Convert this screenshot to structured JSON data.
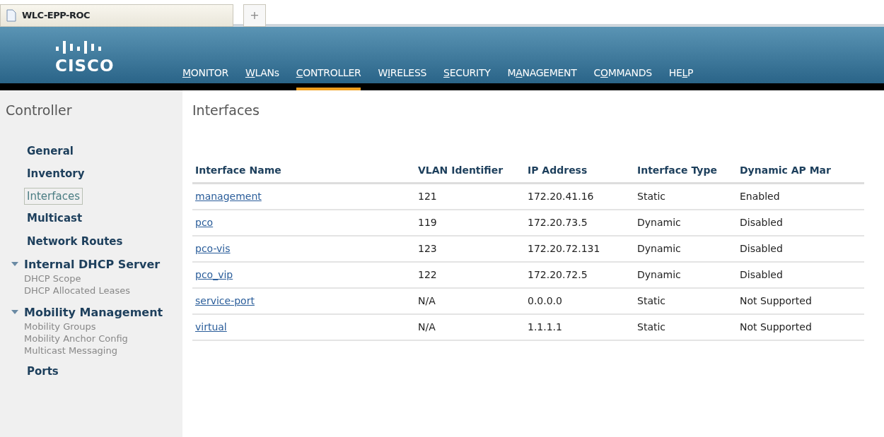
{
  "browser_tab": {
    "title": "WLC-EPP-ROC",
    "new_tab": "+"
  },
  "header": {
    "logo": "CISCO",
    "menu": [
      {
        "parts": [
          {
            "text": "M",
            "underlined": true
          },
          {
            "text": "ONITOR",
            "underlined": false
          }
        ],
        "selected": false
      },
      {
        "parts": [
          {
            "text": "W",
            "underlined": true
          },
          {
            "text": "LANs",
            "underlined": false
          }
        ],
        "selected": false
      },
      {
        "parts": [
          {
            "text": "C",
            "underlined": true
          },
          {
            "text": "ONTROLLER",
            "underlined": false
          }
        ],
        "selected": true
      },
      {
        "parts": [
          {
            "text": "W",
            "underlined": false
          },
          {
            "text": "I",
            "underlined": true
          },
          {
            "text": "RELESS",
            "underlined": false
          }
        ],
        "selected": false
      },
      {
        "parts": [
          {
            "text": "S",
            "underlined": true
          },
          {
            "text": "ECURITY",
            "underlined": false
          }
        ],
        "selected": false
      },
      {
        "parts": [
          {
            "text": "M",
            "underlined": false
          },
          {
            "text": "A",
            "underlined": true
          },
          {
            "text": "NAGEMENT",
            "underlined": false
          }
        ],
        "selected": false
      },
      {
        "parts": [
          {
            "text": "C",
            "underlined": false
          },
          {
            "text": "O",
            "underlined": true
          },
          {
            "text": "MMANDS",
            "underlined": false
          }
        ],
        "selected": false
      },
      {
        "parts": [
          {
            "text": "HE",
            "underlined": false
          },
          {
            "text": "L",
            "underlined": true
          },
          {
            "text": "P",
            "underlined": false
          }
        ],
        "selected": false
      }
    ]
  },
  "sidebar": {
    "title": "Controller",
    "items": [
      {
        "kind": "section",
        "label": "General",
        "selected": false
      },
      {
        "kind": "section",
        "label": "Inventory",
        "selected": false
      },
      {
        "kind": "section",
        "label": "Interfaces",
        "selected": true
      },
      {
        "kind": "section",
        "label": "Multicast",
        "selected": false
      },
      {
        "kind": "section",
        "label": "Network Routes",
        "selected": false
      },
      {
        "kind": "group",
        "label": "Internal DHCP Server",
        "expanded": true,
        "selected": false,
        "children": [
          {
            "label": "DHCP Scope",
            "selected": false
          },
          {
            "label": "DHCP Allocated Leases",
            "selected": false
          }
        ]
      },
      {
        "kind": "group",
        "label": "Mobility Management",
        "expanded": true,
        "selected": false,
        "children": [
          {
            "label": "Mobility Groups",
            "selected": false
          },
          {
            "label": "Mobility Anchor Config",
            "selected": false
          },
          {
            "label": "Multicast Messaging",
            "selected": false
          }
        ]
      },
      {
        "kind": "section",
        "label": "Ports",
        "selected": false
      }
    ]
  },
  "page_title": "Interfaces",
  "table": {
    "columns": [
      "Interface Name",
      "VLAN Identifier",
      "IP Address",
      "Interface Type",
      "Dynamic AP Mar"
    ],
    "rows": [
      [
        "management",
        "121",
        "172.20.41.16",
        "Static",
        "Enabled"
      ],
      [
        "pco",
        "119",
        "172.20.73.5",
        "Dynamic",
        "Disabled"
      ],
      [
        "pco-vis",
        "123",
        "172.20.72.131",
        "Dynamic",
        "Disabled"
      ],
      [
        "pco_vip",
        "122",
        "172.20.72.5",
        "Dynamic",
        "Disabled"
      ],
      [
        "service-port",
        "N/A",
        "0.0.0.0",
        "Static",
        "Not Supported"
      ],
      [
        "virtual",
        "N/A",
        "1.1.1.1",
        "Static",
        "Not Supported"
      ]
    ]
  }
}
